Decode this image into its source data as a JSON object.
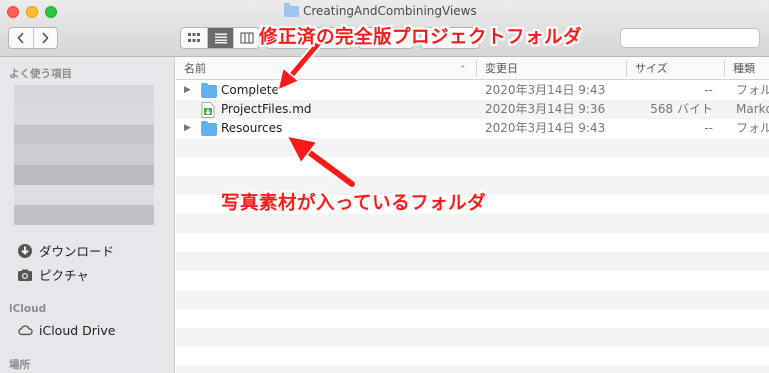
{
  "window": {
    "title": "CreatingAndCombiningViews"
  },
  "toolbar": {
    "back_icon": "chevron-left",
    "forward_icon": "chevron-right"
  },
  "sidebar": {
    "favorites_header": "よく使う項目",
    "favorites": [
      {
        "label": "ダウンロード",
        "icon": "download-icon"
      },
      {
        "label": "ピクチャ",
        "icon": "camera-icon"
      }
    ],
    "icloud_header": "iCloud",
    "icloud_items": [
      {
        "label": "iCloud Drive",
        "icon": "cloud-icon"
      }
    ],
    "places_header": "場所"
  },
  "columns": {
    "name": "名前",
    "date": "変更日",
    "size": "サイズ",
    "kind": "種類"
  },
  "files": [
    {
      "name": "Complete",
      "date": "2020年3月14日 9:43",
      "size": "--",
      "kind": "フォルダ",
      "type": "folder"
    },
    {
      "name": "ProjectFiles.md",
      "date": "2020年3月14日 9:36",
      "size": "568 バイト",
      "kind": "Markdo",
      "type": "markdown"
    },
    {
      "name": "Resources",
      "date": "2020年3月14日 9:43",
      "size": "--",
      "kind": "フォルダ",
      "type": "folder"
    }
  ],
  "annotations": {
    "top": "修正済の完全版プロジェクトフォルダ",
    "middle": "写真素材が入っているフォルダ",
    "color": "#ff1a1a"
  }
}
